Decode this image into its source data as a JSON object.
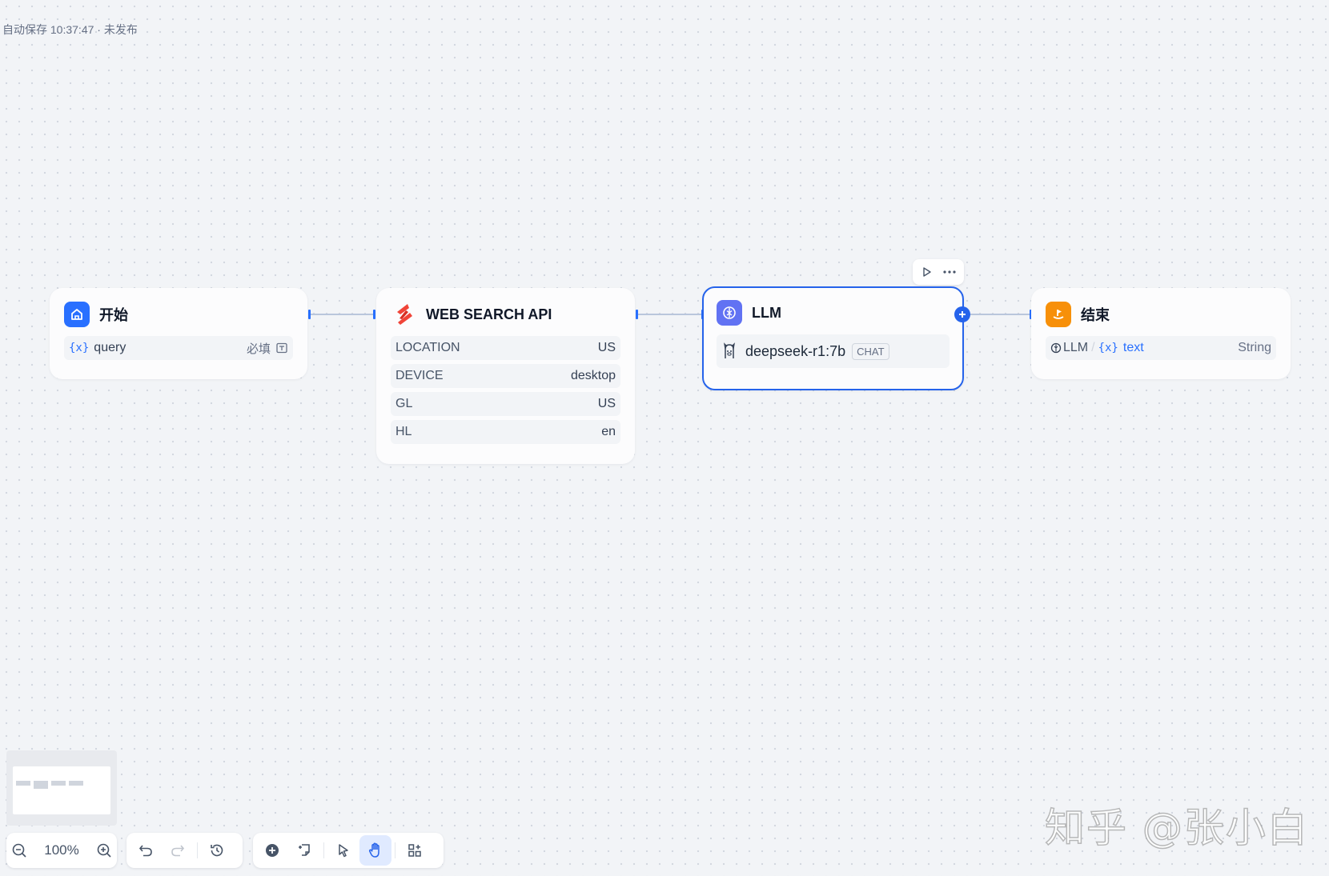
{
  "status": {
    "autosave": "自动保存 10:37:47 · 未发布"
  },
  "nodes": {
    "start": {
      "title": "开始",
      "var_mark": "{x}",
      "var_name": "query",
      "required": "必填",
      "accent": "#2970ff"
    },
    "web_search": {
      "title": "WEB SEARCH API",
      "accent": "#f04438",
      "params": [
        {
          "key": "LOCATION",
          "value": "US"
        },
        {
          "key": "DEVICE",
          "value": "desktop"
        },
        {
          "key": "GL",
          "value": "US"
        },
        {
          "key": "HL",
          "value": "en"
        }
      ]
    },
    "llm": {
      "title": "LLM",
      "model": "deepseek-r1:7b",
      "mode": "CHAT",
      "accent": "#6172f3"
    },
    "end": {
      "title": "结束",
      "source": "LLM",
      "sep": "/",
      "var_mark": "{x}",
      "var_name": "text",
      "type": "String",
      "accent": "#f79009"
    }
  },
  "zoom": {
    "level": "100%"
  },
  "watermark": "知乎 @张小白"
}
